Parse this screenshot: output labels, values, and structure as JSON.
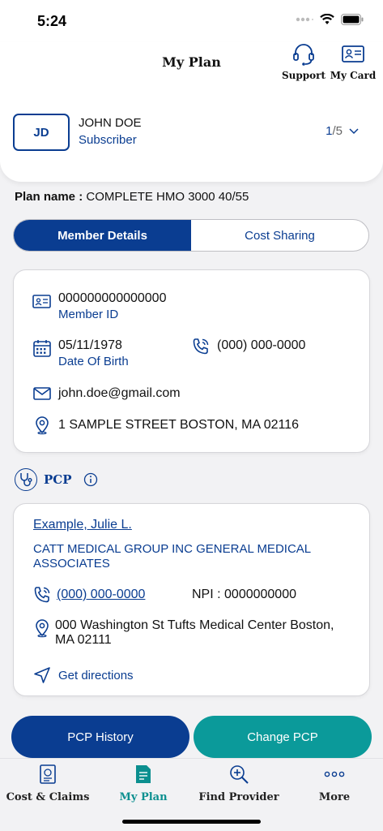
{
  "status": {
    "time": "5:24"
  },
  "header": {
    "title": "My Plan",
    "support_label": "Support",
    "card_label": "My Card"
  },
  "member": {
    "initials": "JD",
    "name": "JOHN DOE",
    "role": "Subscriber",
    "page_current": "1",
    "page_total": "/5"
  },
  "plan": {
    "label": "Plan name :",
    "value": "COMPLETE HMO 3000 40/55"
  },
  "tabs": {
    "member_details": "Member Details",
    "cost_sharing": "Cost Sharing"
  },
  "details": {
    "member_id": "000000000000000",
    "member_id_label": "Member ID",
    "dob": "05/11/1978",
    "dob_label": "Date Of Birth",
    "phone": "(000) 000-0000",
    "email": "john.doe@gmail.com",
    "address": "1 SAMPLE STREET BOSTON, MA 02116"
  },
  "pcp": {
    "title": "PCP",
    "doctor": "Example, Julie L.",
    "group": "CATT MEDICAL GROUP INC GENERAL MEDICAL ASSOCIATES",
    "phone": "(000) 000-0000",
    "npi_label": "NPI :",
    "npi": "0000000000",
    "address": "000 Washington St Tufts Medical Center Boston, MA 02111",
    "directions": "Get directions"
  },
  "buttons": {
    "history": "PCP History",
    "change": "Change PCP"
  },
  "nav": {
    "cost_claims": "Cost & Claims",
    "my_plan": "My Plan",
    "find_provider": "Find Provider",
    "more": "More"
  },
  "colors": {
    "primary": "#0a3d91",
    "teal": "#0b9a9a",
    "active_tab": "#0b8f8f"
  }
}
